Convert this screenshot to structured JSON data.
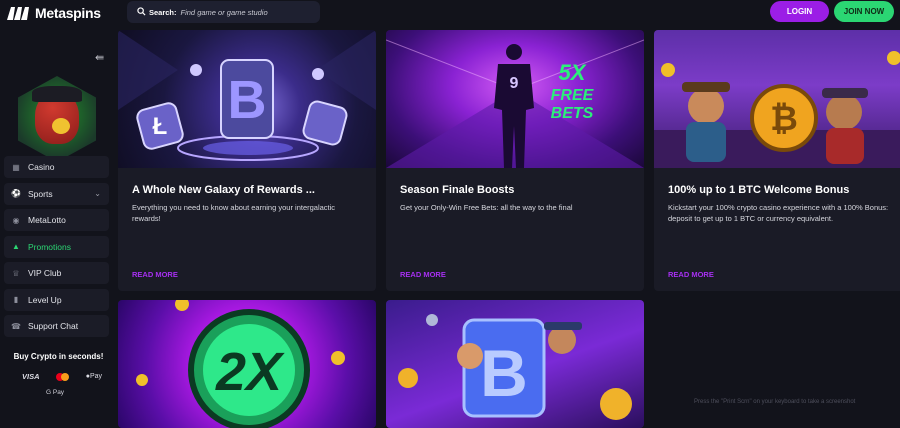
{
  "header": {
    "logo_text": "Metaspins",
    "search_label": "Search:",
    "search_placeholder": "Find game or game studio",
    "login_label": "LOGIN",
    "join_label": "JOIN NOW"
  },
  "sidebar": {
    "items": [
      {
        "label": "Casino",
        "icon": "casino-icon"
      },
      {
        "label": "Sports",
        "icon": "sports-icon"
      },
      {
        "label": "MetaLotto",
        "icon": "lotto-icon"
      },
      {
        "label": "Promotions",
        "icon": "megaphone-icon"
      },
      {
        "label": "VIP Club",
        "icon": "crown-icon"
      },
      {
        "label": "Level Up",
        "icon": "level-icon"
      },
      {
        "label": "Support Chat",
        "icon": "headset-icon"
      }
    ],
    "buy_crypto": "Buy Crypto in seconds!",
    "payments": [
      "VISA",
      "Pay",
      "G Pay"
    ]
  },
  "promos": [
    {
      "title": "A Whole New Galaxy of Rewards ...",
      "description": "Everything you need to know about earning your intergalactic rewards!",
      "cta": "READ MORE",
      "image": "galaxy-crypto-image"
    },
    {
      "title": "Season Finale Boosts",
      "description": "Get your Only-Win Free Bets: all the way to the final",
      "cta": "READ MORE",
      "image": "football-player-image"
    },
    {
      "title": "100% up to 1 BTC Welcome Bonus",
      "description": "Kickstart your 100% crypto casino experience with a 100% Bonus: deposit to get up to 1 BTC or currency equivalent.",
      "cta": "READ MORE",
      "image": "western-characters-image"
    },
    {
      "title": "",
      "description": "",
      "cta": "",
      "image": "2x-coin-image"
    },
    {
      "title": "",
      "description": "",
      "cta": "",
      "image": "bitcoin-cowboys-image"
    }
  ],
  "art_text": {
    "jersey_number": "9",
    "free_bets": [
      "5X",
      "FREE",
      "BETS"
    ],
    "double": "2X"
  },
  "watermark": "Press the \"Print Scrn\" on your keyboard to take a screenshot",
  "colors": {
    "accent_purple": "#9b1ee6",
    "accent_green": "#2bd673",
    "bg": "#12131b"
  }
}
